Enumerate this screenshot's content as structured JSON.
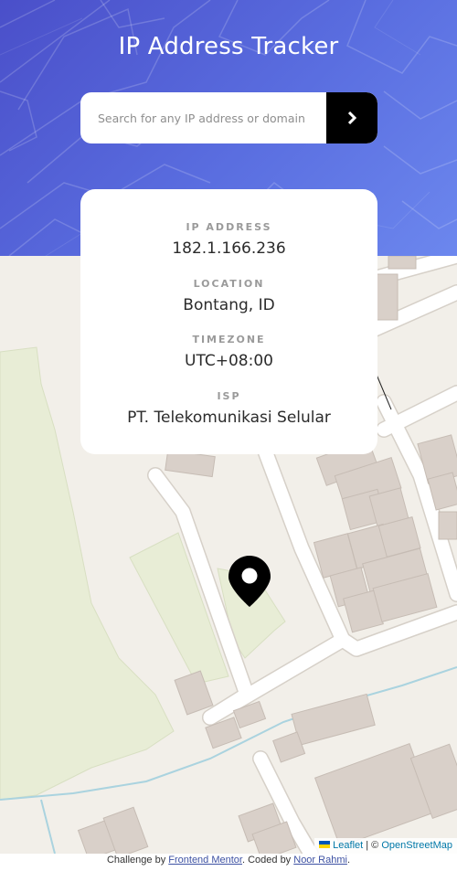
{
  "header": {
    "title": "IP Address Tracker"
  },
  "search": {
    "placeholder": "Search for any IP address or domain",
    "value": "",
    "submit_icon": "chevron-right-icon"
  },
  "info": [
    {
      "label": "IP ADDRESS",
      "value": "182.1.166.236"
    },
    {
      "label": "LOCATION",
      "value": "Bontang, ID"
    },
    {
      "label": "TIMEZONE",
      "value": "UTC+08:00"
    },
    {
      "label": "ISP",
      "value": "PT. Telekomunikasi Selular"
    }
  ],
  "map": {
    "marker_icon": "location-pin-icon",
    "attribution": {
      "leaflet": "Leaflet",
      "separator": " | © ",
      "osm": "OpenStreetMap"
    }
  },
  "footer": {
    "prefix": "Challenge by ",
    "challenge_link": "Frontend Mentor",
    "middle": ". Coded by ",
    "author_link": "Noor Rahmi",
    "suffix": "."
  },
  "colors": {
    "header_gradient_start": "#4a4fc9",
    "header_gradient_end": "#6c87ee",
    "button": "#000000",
    "map_land": "#f2efe9",
    "map_park": "#e8edd6",
    "map_building": "#d9d0c9",
    "map_water": "#aad3df",
    "link": "#0078a8"
  }
}
